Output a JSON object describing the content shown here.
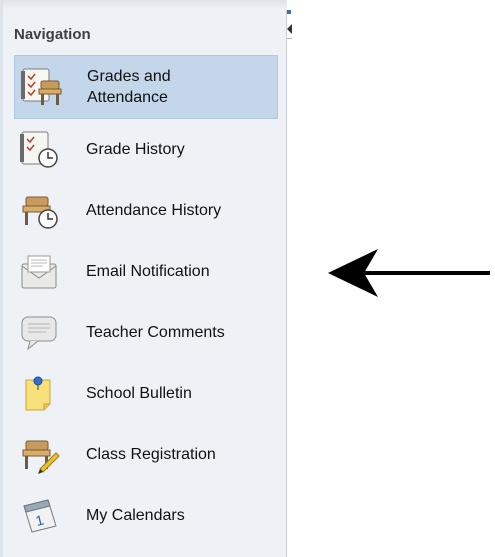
{
  "nav": {
    "title": "Navigation",
    "items": [
      {
        "label": "Grades and Attendance",
        "icon": "grades-attendance-icon",
        "active": true
      },
      {
        "label": "Grade History",
        "icon": "grade-history-icon",
        "active": false
      },
      {
        "label": "Attendance History",
        "icon": "attendance-history-icon",
        "active": false
      },
      {
        "label": "Email Notification",
        "icon": "email-notification-icon",
        "active": false
      },
      {
        "label": "Teacher Comments",
        "icon": "teacher-comments-icon",
        "active": false
      },
      {
        "label": "School Bulletin",
        "icon": "school-bulletin-icon",
        "active": false
      },
      {
        "label": "Class Registration",
        "icon": "class-registration-icon",
        "active": false
      },
      {
        "label": "My Calendars",
        "icon": "my-calendars-icon",
        "active": false
      }
    ]
  },
  "colors": {
    "sidebar_bg": "#eef2f7",
    "active_bg": "#c3d6ea",
    "arrow": "#000000"
  }
}
